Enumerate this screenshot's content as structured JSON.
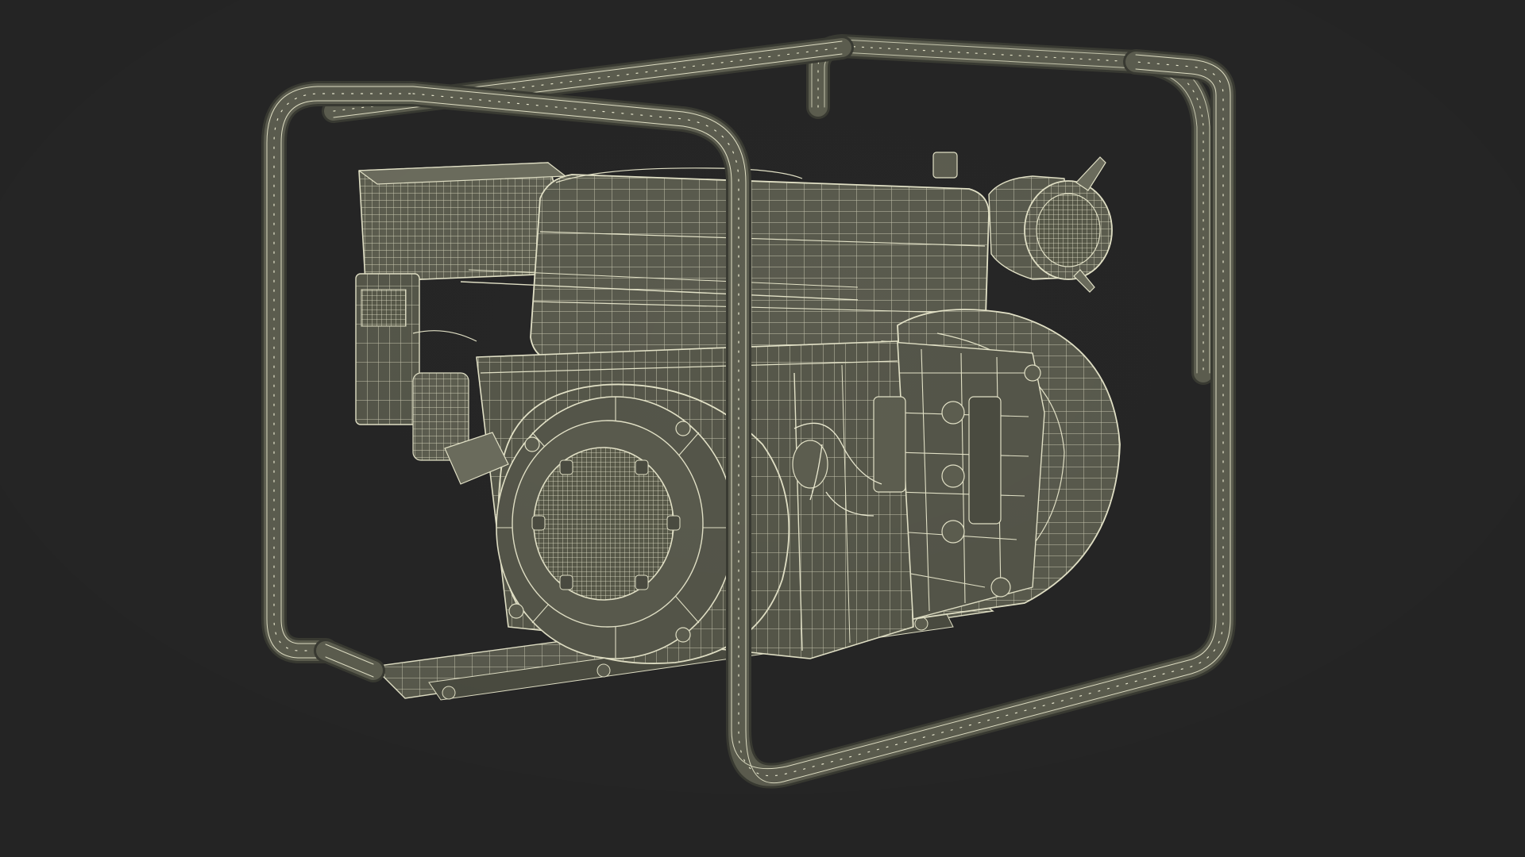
{
  "scene": {
    "subject": "wireframe-render-water-pump",
    "colors": {
      "background": "#262626",
      "mesh_fill": "#5d5e50",
      "mesh_fill_dark": "#4b4c41",
      "mesh_fill_light": "#6c6d5e",
      "wire": "#e4e3c8",
      "wire_dim": "#b9b8a1",
      "tube_edge": "#3a3b33"
    }
  }
}
